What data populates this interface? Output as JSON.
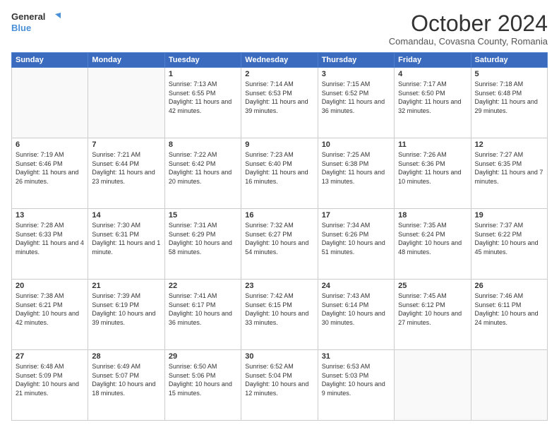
{
  "header": {
    "logo_line1": "General",
    "logo_line2": "Blue",
    "month": "October 2024",
    "location": "Comandau, Covasna County, Romania"
  },
  "weekdays": [
    "Sunday",
    "Monday",
    "Tuesday",
    "Wednesday",
    "Thursday",
    "Friday",
    "Saturday"
  ],
  "weeks": [
    [
      {
        "day": "",
        "info": ""
      },
      {
        "day": "",
        "info": ""
      },
      {
        "day": "1",
        "info": "Sunrise: 7:13 AM\nSunset: 6:55 PM\nDaylight: 11 hours and 42 minutes."
      },
      {
        "day": "2",
        "info": "Sunrise: 7:14 AM\nSunset: 6:53 PM\nDaylight: 11 hours and 39 minutes."
      },
      {
        "day": "3",
        "info": "Sunrise: 7:15 AM\nSunset: 6:52 PM\nDaylight: 11 hours and 36 minutes."
      },
      {
        "day": "4",
        "info": "Sunrise: 7:17 AM\nSunset: 6:50 PM\nDaylight: 11 hours and 32 minutes."
      },
      {
        "day": "5",
        "info": "Sunrise: 7:18 AM\nSunset: 6:48 PM\nDaylight: 11 hours and 29 minutes."
      }
    ],
    [
      {
        "day": "6",
        "info": "Sunrise: 7:19 AM\nSunset: 6:46 PM\nDaylight: 11 hours and 26 minutes."
      },
      {
        "day": "7",
        "info": "Sunrise: 7:21 AM\nSunset: 6:44 PM\nDaylight: 11 hours and 23 minutes."
      },
      {
        "day": "8",
        "info": "Sunrise: 7:22 AM\nSunset: 6:42 PM\nDaylight: 11 hours and 20 minutes."
      },
      {
        "day": "9",
        "info": "Sunrise: 7:23 AM\nSunset: 6:40 PM\nDaylight: 11 hours and 16 minutes."
      },
      {
        "day": "10",
        "info": "Sunrise: 7:25 AM\nSunset: 6:38 PM\nDaylight: 11 hours and 13 minutes."
      },
      {
        "day": "11",
        "info": "Sunrise: 7:26 AM\nSunset: 6:36 PM\nDaylight: 11 hours and 10 minutes."
      },
      {
        "day": "12",
        "info": "Sunrise: 7:27 AM\nSunset: 6:35 PM\nDaylight: 11 hours and 7 minutes."
      }
    ],
    [
      {
        "day": "13",
        "info": "Sunrise: 7:28 AM\nSunset: 6:33 PM\nDaylight: 11 hours and 4 minutes."
      },
      {
        "day": "14",
        "info": "Sunrise: 7:30 AM\nSunset: 6:31 PM\nDaylight: 11 hours and 1 minute."
      },
      {
        "day": "15",
        "info": "Sunrise: 7:31 AM\nSunset: 6:29 PM\nDaylight: 10 hours and 58 minutes."
      },
      {
        "day": "16",
        "info": "Sunrise: 7:32 AM\nSunset: 6:27 PM\nDaylight: 10 hours and 54 minutes."
      },
      {
        "day": "17",
        "info": "Sunrise: 7:34 AM\nSunset: 6:26 PM\nDaylight: 10 hours and 51 minutes."
      },
      {
        "day": "18",
        "info": "Sunrise: 7:35 AM\nSunset: 6:24 PM\nDaylight: 10 hours and 48 minutes."
      },
      {
        "day": "19",
        "info": "Sunrise: 7:37 AM\nSunset: 6:22 PM\nDaylight: 10 hours and 45 minutes."
      }
    ],
    [
      {
        "day": "20",
        "info": "Sunrise: 7:38 AM\nSunset: 6:21 PM\nDaylight: 10 hours and 42 minutes."
      },
      {
        "day": "21",
        "info": "Sunrise: 7:39 AM\nSunset: 6:19 PM\nDaylight: 10 hours and 39 minutes."
      },
      {
        "day": "22",
        "info": "Sunrise: 7:41 AM\nSunset: 6:17 PM\nDaylight: 10 hours and 36 minutes."
      },
      {
        "day": "23",
        "info": "Sunrise: 7:42 AM\nSunset: 6:15 PM\nDaylight: 10 hours and 33 minutes."
      },
      {
        "day": "24",
        "info": "Sunrise: 7:43 AM\nSunset: 6:14 PM\nDaylight: 10 hours and 30 minutes."
      },
      {
        "day": "25",
        "info": "Sunrise: 7:45 AM\nSunset: 6:12 PM\nDaylight: 10 hours and 27 minutes."
      },
      {
        "day": "26",
        "info": "Sunrise: 7:46 AM\nSunset: 6:11 PM\nDaylight: 10 hours and 24 minutes."
      }
    ],
    [
      {
        "day": "27",
        "info": "Sunrise: 6:48 AM\nSunset: 5:09 PM\nDaylight: 10 hours and 21 minutes."
      },
      {
        "day": "28",
        "info": "Sunrise: 6:49 AM\nSunset: 5:07 PM\nDaylight: 10 hours and 18 minutes."
      },
      {
        "day": "29",
        "info": "Sunrise: 6:50 AM\nSunset: 5:06 PM\nDaylight: 10 hours and 15 minutes."
      },
      {
        "day": "30",
        "info": "Sunrise: 6:52 AM\nSunset: 5:04 PM\nDaylight: 10 hours and 12 minutes."
      },
      {
        "day": "31",
        "info": "Sunrise: 6:53 AM\nSunset: 5:03 PM\nDaylight: 10 hours and 9 minutes."
      },
      {
        "day": "",
        "info": ""
      },
      {
        "day": "",
        "info": ""
      }
    ]
  ]
}
